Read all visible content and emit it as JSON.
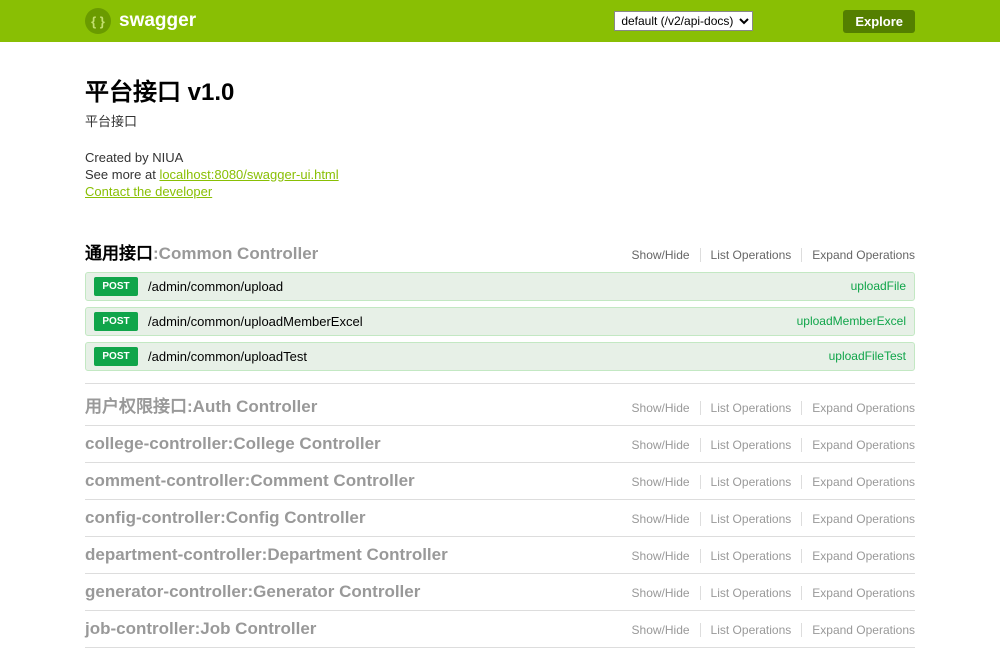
{
  "topbar": {
    "brand": "swagger",
    "select_options": [
      "default (/v2/api-docs)"
    ],
    "selected": "default (/v2/api-docs)",
    "explore": "Explore"
  },
  "info": {
    "title": "平台接口 v1.0",
    "description": "平台接口",
    "created_by": "Created by NIUA",
    "see_more_prefix": "See more at ",
    "see_more_link": "localhost:8080/swagger-ui.html",
    "contact": "Contact the developer"
  },
  "labels": {
    "show_hide": "Show/Hide",
    "list_ops": "List Operations",
    "expand_ops": "Expand Operations",
    "post": "POST",
    "colon_sep": " : "
  },
  "resources": [
    {
      "name": "通用接口",
      "desc": "Common Controller",
      "active": true,
      "endpoints": [
        {
          "method": "POST",
          "path": "/admin/common/upload",
          "summary": "uploadFile"
        },
        {
          "method": "POST",
          "path": "/admin/common/uploadMemberExcel",
          "summary": "uploadMemberExcel"
        },
        {
          "method": "POST",
          "path": "/admin/common/uploadTest",
          "summary": "uploadFileTest"
        }
      ]
    },
    {
      "name": "用户权限接口",
      "desc": "Auth Controller",
      "active": false,
      "endpoints": []
    },
    {
      "name": "college-controller",
      "desc": "College Controller",
      "active": false,
      "endpoints": []
    },
    {
      "name": "comment-controller",
      "desc": "Comment Controller",
      "active": false,
      "endpoints": []
    },
    {
      "name": "config-controller",
      "desc": "Config Controller",
      "active": false,
      "endpoints": []
    },
    {
      "name": "department-controller",
      "desc": "Department Controller",
      "active": false,
      "endpoints": []
    },
    {
      "name": "generator-controller",
      "desc": "Generator Controller",
      "active": false,
      "endpoints": []
    },
    {
      "name": "job-controller",
      "desc": "Job Controller",
      "active": false,
      "endpoints": []
    }
  ]
}
